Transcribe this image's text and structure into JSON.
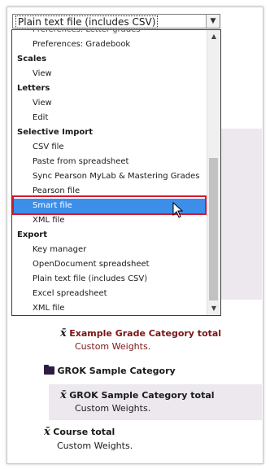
{
  "select": {
    "value": "Plain text file (includes CSV)",
    "arrow_icon": "chevron-down-icon"
  },
  "dropdown": {
    "clipped_top": "Preferences: Letter grades",
    "items": [
      {
        "kind": "child",
        "label": "Preferences: Gradebook"
      },
      {
        "kind": "group",
        "label": "Scales"
      },
      {
        "kind": "child",
        "label": "View"
      },
      {
        "kind": "group",
        "label": "Letters"
      },
      {
        "kind": "child",
        "label": "View"
      },
      {
        "kind": "child",
        "label": "Edit"
      },
      {
        "kind": "group",
        "label": "Selective Import"
      },
      {
        "kind": "child",
        "label": "CSV file"
      },
      {
        "kind": "child",
        "label": "Paste from spreadsheet"
      },
      {
        "kind": "child",
        "label": "Sync Pearson MyLab & Mastering Grades"
      },
      {
        "kind": "child",
        "label": "Pearson file"
      },
      {
        "kind": "child",
        "label": "Smart file",
        "selected": true
      },
      {
        "kind": "child",
        "label": "XML file"
      },
      {
        "kind": "group",
        "label": "Export"
      },
      {
        "kind": "child",
        "label": "Key manager"
      },
      {
        "kind": "child",
        "label": "OpenDocument spreadsheet"
      },
      {
        "kind": "child",
        "label": "Plain text file (includes CSV)"
      },
      {
        "kind": "child",
        "label": "Excel spreadsheet"
      },
      {
        "kind": "child",
        "label": "XML file"
      }
    ],
    "selected_color": "#3d8ee8"
  },
  "highlight_color": "#d5192c",
  "gradebook": {
    "mean_symbol": "x̄",
    "example_total": {
      "title": "Example Grade Category total",
      "sub": "Custom Weights."
    },
    "grok_category": {
      "title": "GROK Sample Category",
      "icon": "folder-icon"
    },
    "grok_total": {
      "title": "GROK Sample Category total",
      "sub": "Custom Weights."
    },
    "course_total": {
      "title": "Course total",
      "sub": "Custom Weights."
    },
    "accent_red": "#7a1416"
  }
}
